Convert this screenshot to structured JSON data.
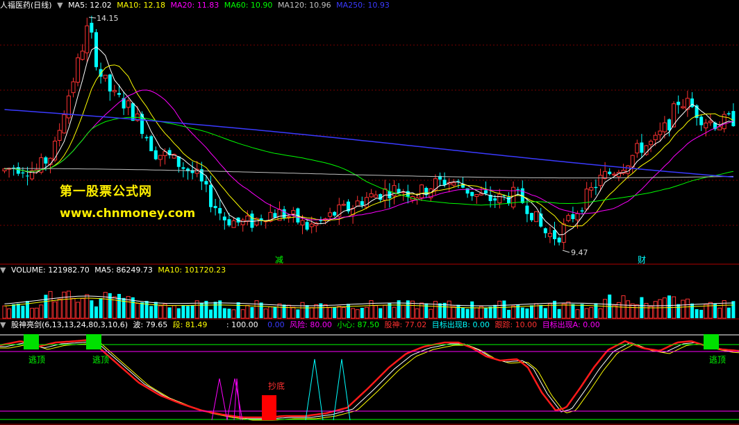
{
  "header": {
    "stock_name": "人福医药(日线)",
    "ma_items": [
      {
        "label": "MA5: 12.02",
        "color": "#ffffff"
      },
      {
        "label": "MA10: 12.18",
        "color": "#ffff00"
      },
      {
        "label": "MA20: 11.83",
        "color": "#ff00ff"
      },
      {
        "label": "MA60: 10.90",
        "color": "#00ff00"
      },
      {
        "label": "MA120: 10.96",
        "color": "#c0c0c0"
      },
      {
        "label": "MA250: 10.93",
        "color": "#3a3aff"
      }
    ]
  },
  "volume_header": {
    "label": "VOLUME: 121982.70",
    "ma5": "MA5: 86249.73",
    "ma10": "MA10: 101720.23"
  },
  "indicator_header": {
    "name": "股神亮剑(6,13,13,24,80,3,10,6)",
    "items": [
      {
        "label": "波: 79.65",
        "color": "#ffffff"
      },
      {
        "label": "段: 81.49",
        "color": "#ffff00"
      },
      {
        "label": ": 100.00",
        "color": "#ffffff"
      },
      {
        "label": "0.00",
        "color": "#3a3aff"
      },
      {
        "label": "风险: 80.00",
        "color": "#ff00ff"
      },
      {
        "label": "小心: 87.50",
        "color": "#00ff00"
      },
      {
        "label": "股神: 77.02",
        "color": "#ff3030"
      },
      {
        "label": "目标出现B: 0.00",
        "color": "#00ffff"
      },
      {
        "label": "跟踪: 10.00",
        "color": "#ff3030"
      },
      {
        "label": "目标出现A: 0.00",
        "color": "#ff00ff"
      }
    ]
  },
  "annotations": {
    "high": "14.15",
    "low": "9.47",
    "mark_jian": "减",
    "mark_cai": "财",
    "escape1": "逃顶",
    "escape2": "逃顶",
    "escape3": "逃顶",
    "bottom": "抄底"
  },
  "watermark": {
    "line1": "第一股票公式网",
    "line2": "www.chnmoney.com"
  },
  "colors": {
    "up": "#ff3232",
    "down": "#00ffff",
    "ma5": "#ffffff",
    "ma10": "#ffff00",
    "ma20": "#ff00ff",
    "ma60": "#00ff00",
    "ma120": "#c0c0c0",
    "ma250": "#3a3aff"
  },
  "chart_data": {
    "type": "candlestick",
    "price_range": [
      9.47,
      14.15
    ],
    "price_close_points": [
      [
        0,
        11.0
      ],
      [
        20,
        11.1
      ],
      [
        50,
        11.0
      ],
      [
        75,
        11.4
      ],
      [
        90,
        12.3
      ],
      [
        110,
        13.3
      ],
      [
        125,
        14.1
      ],
      [
        140,
        13.1
      ],
      [
        160,
        12.6
      ],
      [
        180,
        12.4
      ],
      [
        200,
        12.0
      ],
      [
        220,
        11.4
      ],
      [
        240,
        11.3
      ],
      [
        260,
        11.1
      ],
      [
        280,
        10.9
      ],
      [
        300,
        10.4
      ],
      [
        320,
        10.0
      ],
      [
        340,
        9.9
      ],
      [
        360,
        9.9
      ],
      [
        380,
        10.1
      ],
      [
        400,
        10.1
      ],
      [
        420,
        10.0
      ],
      [
        440,
        9.8
      ],
      [
        460,
        9.9
      ],
      [
        480,
        10.1
      ],
      [
        500,
        10.2
      ],
      [
        520,
        10.4
      ],
      [
        540,
        10.5
      ],
      [
        560,
        10.6
      ],
      [
        580,
        10.6
      ],
      [
        600,
        10.5
      ],
      [
        620,
        10.7
      ],
      [
        640,
        10.8
      ],
      [
        660,
        10.7
      ],
      [
        680,
        10.5
      ],
      [
        700,
        10.4
      ],
      [
        720,
        10.4
      ],
      [
        740,
        10.5
      ],
      [
        760,
        10.2
      ],
      [
        780,
        9.7
      ],
      [
        800,
        9.6
      ],
      [
        820,
        10.0
      ],
      [
        840,
        10.4
      ],
      [
        860,
        10.8
      ],
      [
        880,
        11.0
      ],
      [
        900,
        11.2
      ],
      [
        920,
        11.5
      ],
      [
        940,
        11.6
      ],
      [
        960,
        12.0
      ],
      [
        975,
        12.5
      ],
      [
        990,
        12.4
      ],
      [
        1010,
        12.1
      ],
      [
        1030,
        12.0
      ],
      [
        1055,
        12.1
      ]
    ]
  }
}
